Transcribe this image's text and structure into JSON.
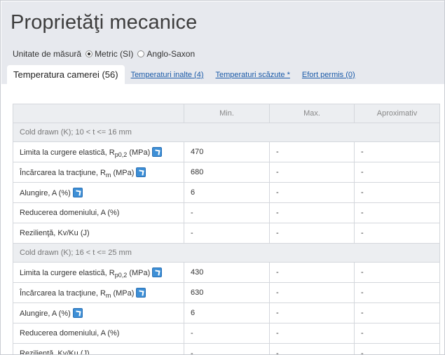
{
  "header": {
    "title": "Proprietăţi mecanice"
  },
  "units": {
    "label": "Unitate de măsură",
    "options": [
      {
        "label": "Metric (SI)",
        "selected": true
      },
      {
        "label": "Anglo-Saxon",
        "selected": false
      }
    ]
  },
  "tabs": [
    {
      "label": "Temperatura camerei (56)",
      "active": true
    },
    {
      "label": "Temperaturi inalte (4)",
      "active": false
    },
    {
      "label": "Temperaturi scăzute *",
      "active": false
    },
    {
      "label": "Efort permis (0)",
      "active": false
    }
  ],
  "table": {
    "columns": [
      "",
      "Min.",
      "Max.",
      "Aproximativ"
    ],
    "groups": [
      {
        "title": "Cold drawn (K); 10 < t <= 16 mm",
        "rows": [
          {
            "name": "Limita la curgere elastică, R",
            "sub": "p0,2",
            "unit": " (MPa)",
            "icon": true,
            "min": "470",
            "max": "-",
            "approx": "-"
          },
          {
            "name": "Încărcarea la tracţiune, R",
            "sub": "m",
            "unit": " (MPa)",
            "icon": true,
            "min": "680",
            "max": "-",
            "approx": "-"
          },
          {
            "name": "Alungire, A (%)",
            "sub": "",
            "unit": "",
            "icon": true,
            "min": "6",
            "max": "-",
            "approx": "-"
          },
          {
            "name": "Reducerea domeniului, A (%)",
            "sub": "",
            "unit": "",
            "icon": false,
            "min": "-",
            "max": "-",
            "approx": "-"
          },
          {
            "name": "Rezilienţă, Kv/Ku (J)",
            "sub": "",
            "unit": "",
            "icon": false,
            "min": "-",
            "max": "-",
            "approx": "-"
          }
        ]
      },
      {
        "title": "Cold drawn (K); 16 < t <= 25 mm",
        "rows": [
          {
            "name": "Limita la curgere elastică, R",
            "sub": "p0,2",
            "unit": " (MPa)",
            "icon": true,
            "min": "430",
            "max": "-",
            "approx": "-"
          },
          {
            "name": "Încărcarea la tracţiune, R",
            "sub": "m",
            "unit": " (MPa)",
            "icon": true,
            "min": "630",
            "max": "-",
            "approx": "-"
          },
          {
            "name": "Alungire, A (%)",
            "sub": "",
            "unit": "",
            "icon": true,
            "min": "6",
            "max": "-",
            "approx": "-"
          },
          {
            "name": "Reducerea domeniului, A (%)",
            "sub": "",
            "unit": "",
            "icon": false,
            "min": "-",
            "max": "-",
            "approx": "-"
          },
          {
            "name": "Rezilienţă, Kv/Ku (J)",
            "sub": "",
            "unit": "",
            "icon": false,
            "min": "-",
            "max": "-",
            "approx": "-"
          }
        ]
      }
    ]
  }
}
